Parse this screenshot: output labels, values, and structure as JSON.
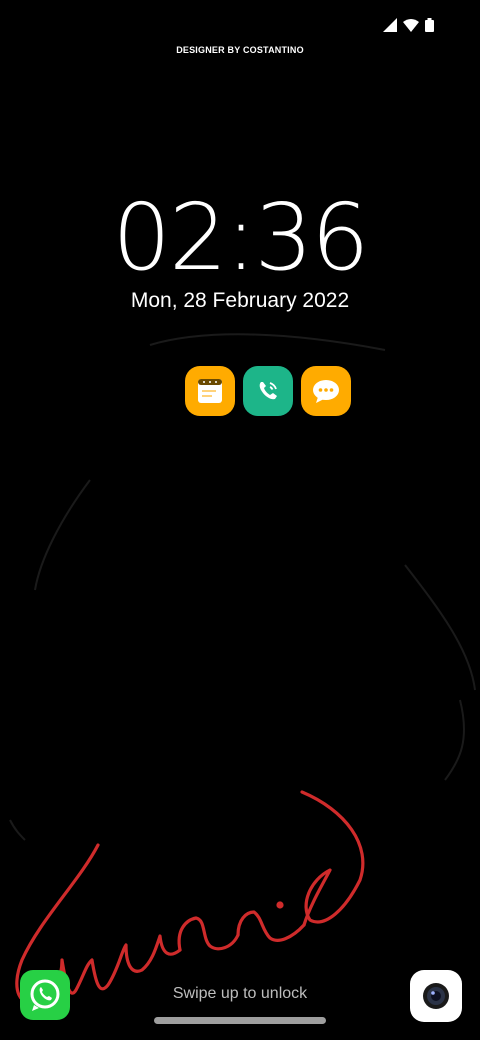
{
  "status_bar": {
    "icons": [
      "cell-signal-icon",
      "wifi-icon",
      "battery-icon"
    ]
  },
  "wallpaper": {
    "credit": "DESIGNER BY COSTANTINO",
    "script_word": "music",
    "script_color": "#d32f2f"
  },
  "clock": {
    "time": "02:36",
    "date": "Mon, 28 February 2022"
  },
  "notifications": [
    {
      "app": "notes-icon",
      "color": "#ffab00"
    },
    {
      "app": "phone-icon",
      "color": "#1db589"
    },
    {
      "app": "messages-icon",
      "color": "#ffab00"
    }
  ],
  "lock": {
    "hint": "Swipe up to unlock"
  },
  "shortcuts": {
    "left": "whatsapp-icon",
    "right": "camera-icon"
  }
}
